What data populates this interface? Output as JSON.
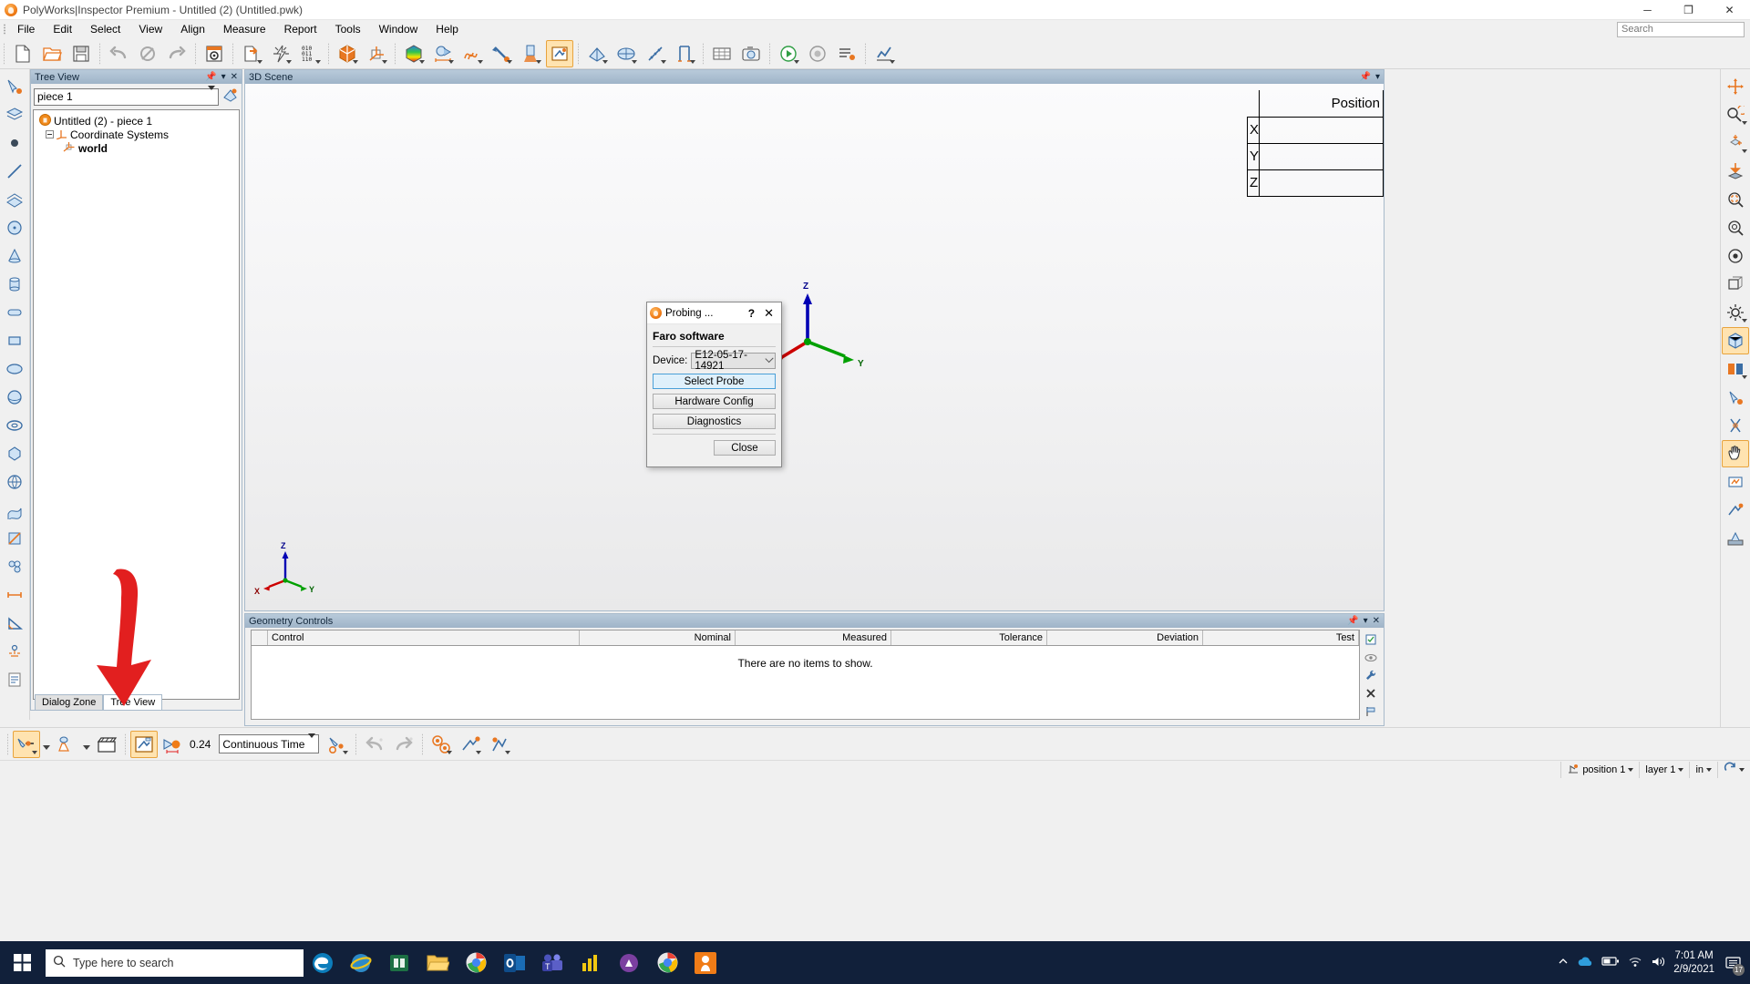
{
  "window": {
    "title": "PolyWorks|Inspector Premium - Untitled (2) (Untitled.pwk)",
    "minimize": "─",
    "maximize": "❐",
    "close": "✕",
    "app_icon": "polyworks-icon"
  },
  "menubar": {
    "items": [
      {
        "label": "File",
        "accel": "F"
      },
      {
        "label": "Edit",
        "accel": "E"
      },
      {
        "label": "Select",
        "accel": "S"
      },
      {
        "label": "View",
        "accel": "V"
      },
      {
        "label": "Align",
        "accel": "A"
      },
      {
        "label": "Measure",
        "accel": "M"
      },
      {
        "label": "Report",
        "accel": "R"
      },
      {
        "label": "Tools",
        "accel": "T"
      },
      {
        "label": "Window",
        "accel": "W"
      },
      {
        "label": "Help",
        "accel": "H"
      }
    ],
    "search_placeholder": "Search"
  },
  "toolbar": {
    "items": [
      {
        "name": "new-file-icon"
      },
      {
        "name": "open-folder-icon"
      },
      {
        "name": "save-icon"
      },
      {
        "name": "undo-icon"
      },
      {
        "name": "undo-all-icon"
      },
      {
        "name": "redo-icon"
      },
      {
        "name": "options-icon"
      },
      {
        "name": "import-file-icon"
      },
      {
        "name": "flash-icon"
      },
      {
        "name": "binary-data-icon"
      },
      {
        "name": "align-object-icon"
      },
      {
        "name": "coordinate-system-icon"
      },
      {
        "name": "color-cube-icon"
      },
      {
        "name": "measure-distance-icon"
      },
      {
        "name": "curve-icon"
      },
      {
        "name": "probe-vector-icon"
      },
      {
        "name": "scan-icon"
      },
      {
        "name": "annotation-icon"
      },
      {
        "name": "probing-device-icon"
      },
      {
        "name": "cad-object-icon"
      },
      {
        "name": "feature-table-icon"
      },
      {
        "name": "measure-tool-icon"
      },
      {
        "name": "caliper-icon"
      },
      {
        "name": "grid-table-icon"
      },
      {
        "name": "camera-icon"
      },
      {
        "name": "play-icon"
      },
      {
        "name": "record-icon"
      },
      {
        "name": "playlist-icon"
      },
      {
        "name": "chart-icon"
      }
    ]
  },
  "left_toolbar": {
    "items": [
      {
        "name": "probe-select-icon"
      },
      {
        "name": "layers-icon"
      },
      {
        "name": "point-icon"
      },
      {
        "name": "line-icon"
      },
      {
        "name": "plane-icon"
      },
      {
        "name": "circle-icon"
      },
      {
        "name": "cone-icon"
      },
      {
        "name": "cylinder-icon"
      },
      {
        "name": "slot-icon"
      },
      {
        "name": "rectangle-icon"
      },
      {
        "name": "ellipse-icon"
      },
      {
        "name": "sphere-icon"
      },
      {
        "name": "torus-icon"
      },
      {
        "name": "polygon-icon"
      },
      {
        "name": "globe-icon"
      },
      {
        "name": "surface-icon"
      },
      {
        "name": "cross-section-icon"
      },
      {
        "name": "group-icon"
      },
      {
        "name": "distance-icon"
      },
      {
        "name": "angle-icon"
      },
      {
        "name": "gdt-icon"
      },
      {
        "name": "report-icon"
      }
    ]
  },
  "right_toolbar": {
    "items": [
      {
        "name": "pan-zoom-icon"
      },
      {
        "name": "zoom-rotate-icon"
      },
      {
        "name": "fit-object-icon"
      },
      {
        "name": "drop-to-plane-icon"
      },
      {
        "name": "zoom-window-icon"
      },
      {
        "name": "zoom-extents-icon"
      },
      {
        "name": "view-target-icon"
      },
      {
        "name": "perspective-icon"
      },
      {
        "name": "display-settings-icon"
      },
      {
        "name": "render-mode-icon",
        "active": true
      },
      {
        "name": "color-map-icon"
      },
      {
        "name": "light-icon"
      },
      {
        "name": "clipping-icon"
      },
      {
        "name": "pan-hand-icon",
        "active": true
      },
      {
        "name": "measure-view-icon"
      },
      {
        "name": "probe-view-icon"
      },
      {
        "name": "device-view-icon"
      }
    ]
  },
  "tree_view": {
    "panel_title": "Tree View",
    "piece_selector": "piece 1",
    "nodes": [
      {
        "label": "Untitled (2) - piece 1",
        "icon": "project-icon",
        "indent": 0,
        "bold": false
      },
      {
        "label": "Coordinate Systems",
        "icon": "coordinate-systems-icon",
        "indent": 1,
        "bold": false
      },
      {
        "label": "world",
        "icon": "world-axes-icon",
        "indent": 2,
        "bold": true
      }
    ],
    "tabs": [
      {
        "label": "Dialog Zone",
        "selected": false
      },
      {
        "label": "Tree View",
        "selected": true
      }
    ]
  },
  "scene": {
    "panel_title": "3D Scene",
    "position_table": {
      "header": "Position",
      "rows": [
        {
          "axis": "X",
          "value": ""
        },
        {
          "axis": "Y",
          "value": ""
        },
        {
          "axis": "Z",
          "value": ""
        }
      ]
    },
    "axes": {
      "main": {
        "x": "X",
        "y": "Y",
        "z": "Z"
      },
      "corner": {
        "x": "X",
        "y": "Y",
        "z": "Z"
      }
    }
  },
  "geometry_controls": {
    "panel_title": "Geometry Controls",
    "columns": [
      "Control",
      "Nominal",
      "Measured",
      "Tolerance",
      "Deviation",
      "Test"
    ],
    "empty_message": "There are no items to show.",
    "rows": [],
    "side_icons": [
      {
        "name": "edit-control-icon"
      },
      {
        "name": "hide-control-icon"
      },
      {
        "name": "wrench-icon"
      },
      {
        "name": "delete-control-icon"
      },
      {
        "name": "flag-icon"
      }
    ]
  },
  "dialog": {
    "title": "Probing ...",
    "help_label": "?",
    "close_label": "✕",
    "heading": "Faro software",
    "device_label": "Device:",
    "device_value": "E12-05-17-14921",
    "buttons": [
      {
        "label": "Select Probe",
        "primary": true,
        "name": "select-probe-button"
      },
      {
        "label": "Hardware Config",
        "primary": false,
        "name": "hardware-config-button"
      },
      {
        "label": "Diagnostics",
        "primary": false,
        "name": "diagnostics-button"
      }
    ],
    "close_button": "Close"
  },
  "bottom_toolbar": {
    "probe_value": "0.24",
    "mode_selector": "Continuous Time",
    "items": [
      {
        "name": "probe-mode-icon",
        "active": true
      },
      {
        "name": "scan-mode-icon"
      },
      {
        "name": "clapper-icon"
      },
      {
        "name": "probe-window-icon",
        "active": true
      },
      {
        "name": "probe-radius-icon"
      },
      {
        "name": "probe-settings-icon"
      },
      {
        "name": "undo-probe-icon"
      },
      {
        "name": "redo-probe-icon"
      },
      {
        "name": "target-points-icon"
      },
      {
        "name": "feature-probe-icon"
      },
      {
        "name": "device-probe-icon"
      }
    ]
  },
  "status_bar": {
    "position": "position 1",
    "layer": "layer 1",
    "units": "in",
    "refresh_icon": "refresh-icon"
  },
  "taskbar": {
    "search_placeholder": "Type here to search",
    "apps": [
      {
        "name": "edge-icon"
      },
      {
        "name": "internet-explorer-icon"
      },
      {
        "name": "excel-icon"
      },
      {
        "name": "file-explorer-icon"
      },
      {
        "name": "chrome-icon"
      },
      {
        "name": "outlook-icon"
      },
      {
        "name": "teams-icon"
      },
      {
        "name": "powerbi-icon"
      },
      {
        "name": "store-icon"
      },
      {
        "name": "chrome2-icon"
      },
      {
        "name": "polyworks-taskbar-icon"
      }
    ],
    "time": "7:01 AM",
    "date": "2/9/2021",
    "notification_count": "17"
  },
  "colors": {
    "accent_orange": "#e87722",
    "panel_blue": "#9fb4c8",
    "annotation_red": "#e21f1f",
    "axis_x": "#cc0000",
    "axis_y": "#00a000",
    "axis_z": "#0000b4"
  }
}
